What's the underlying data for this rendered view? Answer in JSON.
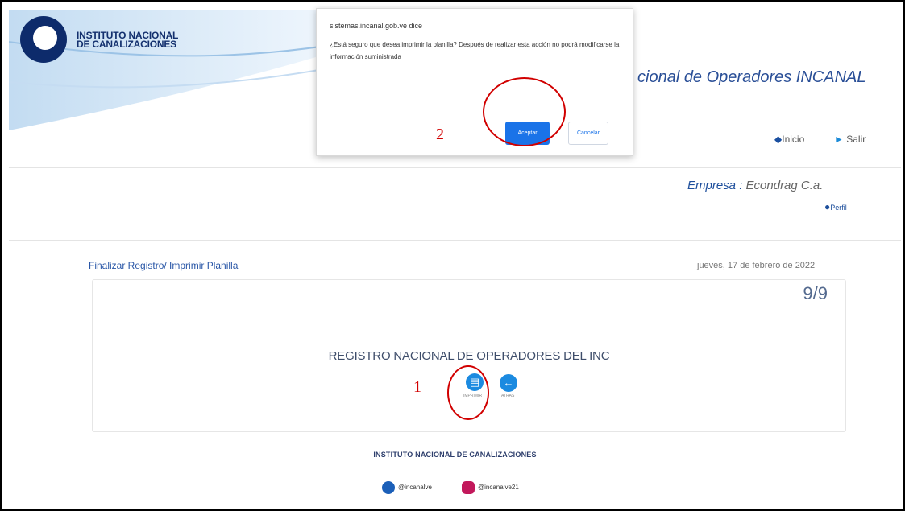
{
  "header": {
    "logo_line1": "INSTITUTO NACIONAL",
    "logo_line2": "DE CANALIZACIONES",
    "app_title": "cional de Operadores INCANAL",
    "nav_home": "Inicio",
    "nav_exit": "Salir"
  },
  "company": {
    "label": "Empresa : ",
    "name": "Econdrag C.a.",
    "profile": "Perfil"
  },
  "main": {
    "breadcrumb": "Finalizar Registro/ Imprimir Planilla",
    "date": "jueves, 17 de febrero de 2022",
    "step": "9/9",
    "card_title": "REGISTRO NACIONAL DE OPERADORES DEL INC",
    "print_label": "IMPRIMIR",
    "back_label": "ATRAS"
  },
  "footer": {
    "title": "INSTITUTO NACIONAL DE CANALIZACIONES",
    "twitter": "@incanalve",
    "instagram": "@incanalve21"
  },
  "dialog": {
    "origin": "sistemas.incanal.gob.ve dice",
    "message": "¿Está seguro que desea imprimir la planilla? Después de realizar esta acción no podrá modificarse la información suministrada",
    "accept": "Aceptar",
    "cancel": "Cancelar"
  },
  "annotations": {
    "one": "1",
    "two": "2"
  },
  "colors": {
    "brand_blue": "#1e4f9c",
    "button_blue": "#1b8ae0",
    "annotation_red": "#d10000"
  }
}
